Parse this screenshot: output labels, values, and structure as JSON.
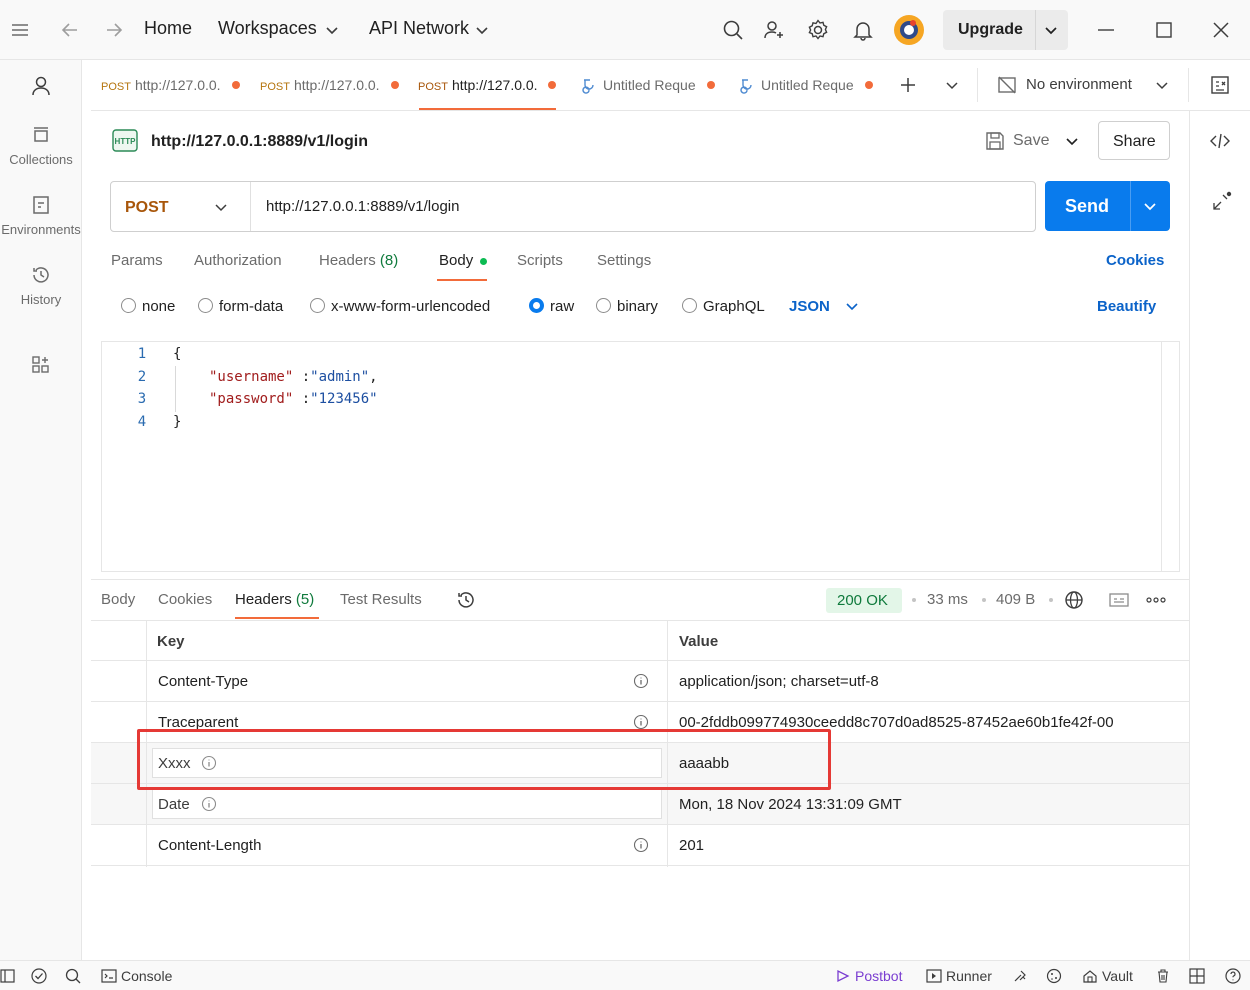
{
  "titlebar": {
    "home": "Home",
    "workspaces": "Workspaces",
    "api_network": "API Network",
    "upgrade": "Upgrade"
  },
  "sidebar": {
    "items": [
      {
        "label": "Collections",
        "icon": "collections-icon"
      },
      {
        "label": "Environments",
        "icon": "environments-icon"
      },
      {
        "label": "History",
        "icon": "history-icon"
      }
    ]
  },
  "tabs": [
    {
      "method": "POST",
      "title": "http://127.0.0.",
      "active": false
    },
    {
      "method": "POST",
      "title": "http://127.0.0.",
      "active": false
    },
    {
      "method": "POST",
      "title": "http://127.0.0.",
      "active": true
    },
    {
      "method": "",
      "title": "Untitled Reque",
      "active": false
    },
    {
      "method": "",
      "title": "Untitled Reque",
      "active": false
    }
  ],
  "environment": {
    "label": "No environment"
  },
  "request": {
    "protocol_badge": "HTTP",
    "title": "http://127.0.0.1:8889/v1/login",
    "save": "Save",
    "share": "Share",
    "method": "POST",
    "url": "http://127.0.0.1:8889/v1/login",
    "send": "Send"
  },
  "request_tabs": {
    "params": "Params",
    "authorization": "Authorization",
    "headers": "Headers",
    "headers_count": "(8)",
    "body": "Body",
    "scripts": "Scripts",
    "settings": "Settings",
    "cookies": "Cookies"
  },
  "body_modes": {
    "none": "none",
    "form_data": "form-data",
    "urlencoded": "x-www-form-urlencoded",
    "raw": "raw",
    "binary": "binary",
    "graphql": "GraphQL",
    "format": "JSON",
    "beautify": "Beautify",
    "selected": "raw"
  },
  "code": {
    "line_numbers": [
      "1",
      "2",
      "3",
      "4"
    ],
    "line1": "{",
    "line2_key": "\"username\"",
    "line2_sep": " :",
    "line2_val": "\"admin\"",
    "line2_end": ",",
    "line3_key": "\"password\"",
    "line3_sep": " :",
    "line3_val": "\"123456\"",
    "line4": "}"
  },
  "response": {
    "tabs": {
      "body": "Body",
      "cookies": "Cookies",
      "headers": "Headers",
      "headers_count": "(5)",
      "test_results": "Test Results"
    },
    "status": "200 OK",
    "time": "33 ms",
    "size": "409 B",
    "columns": {
      "key": "Key",
      "value": "Value"
    },
    "headers": [
      {
        "key": "Content-Type",
        "value": "application/json; charset=utf-8"
      },
      {
        "key": "Traceparent",
        "value": "00-2fddb099774930ceedd8c707d0ad8525-87452ae60b1fe42f-00"
      },
      {
        "key": "Xxxx",
        "value": "aaaabb"
      },
      {
        "key": "Date",
        "value": "Mon, 18 Nov 2024 13:31:09 GMT"
      },
      {
        "key": "Content-Length",
        "value": "201"
      }
    ]
  },
  "statusbar": {
    "console": "Console",
    "postbot": "Postbot",
    "runner": "Runner",
    "vault": "Vault"
  },
  "colors": {
    "accent_orange": "#f26b3a",
    "send_blue": "#097bed",
    "status_green": "#0f7a3c",
    "highlight_red": "#e53935"
  }
}
